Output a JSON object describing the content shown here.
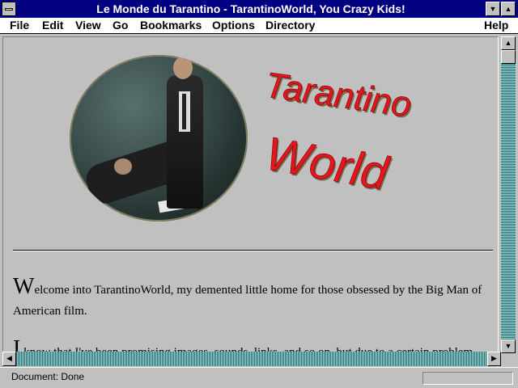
{
  "window": {
    "title": "Le Monde du Tarantino - TarantinoWorld, You Crazy Kids!"
  },
  "menu": {
    "file": "File",
    "edit": "Edit",
    "view": "View",
    "go": "Go",
    "bookmarks": "Bookmarks",
    "options": "Options",
    "directory": "Directory",
    "help": "Help"
  },
  "logo": {
    "line1": "Tarantino",
    "line2": "World",
    "color": "#e8141e"
  },
  "content": {
    "p1_drop": "W",
    "p1_text": "elcome into TarantinoWorld, my demented little home for those obsessed by the Big Man of American film.",
    "p2_drop": "I",
    "p2_text": " know that I've been promising images, sounds, links, and so on, but due to a certain problem"
  },
  "status": {
    "text": "Document: Done"
  },
  "colors": {
    "titlebar": "#000080",
    "scroll_track": "#008080",
    "chrome": "#c0c0c0"
  },
  "icons": {
    "sysmenu": "system-menu-icon",
    "minimize": "minimize-arrow-icon",
    "maximize": "maximize-arrow-icon",
    "scroll_up": "scroll-up-arrow-icon",
    "scroll_down": "scroll-down-arrow-icon",
    "scroll_left": "scroll-left-arrow-icon",
    "scroll_right": "scroll-right-arrow-icon"
  }
}
